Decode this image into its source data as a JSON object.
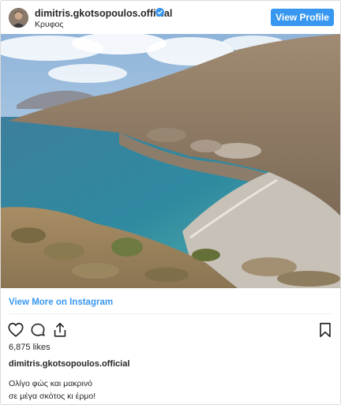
{
  "post": {
    "username": "dimitris.gkotsopoulos.official",
    "location": "Κρυφος",
    "verified_icon": "verified-badge-icon",
    "view_profile_label": "View Profile",
    "view_more_label": "View More on Instagram",
    "likes": "6,875 likes",
    "caption_username": "dimitris.gkotsopoulos.official",
    "caption_lines": [
      "Ολίγο φώς και μακρινό",
      "σε μέγα σκότος κι έρμο!"
    ]
  },
  "icons": {
    "like": "heart-icon",
    "comment": "comment-icon",
    "share": "share-icon",
    "save": "bookmark-icon"
  },
  "colors": {
    "accent": "#3897f0",
    "text": "#262626",
    "border": "#dbdbdb"
  }
}
